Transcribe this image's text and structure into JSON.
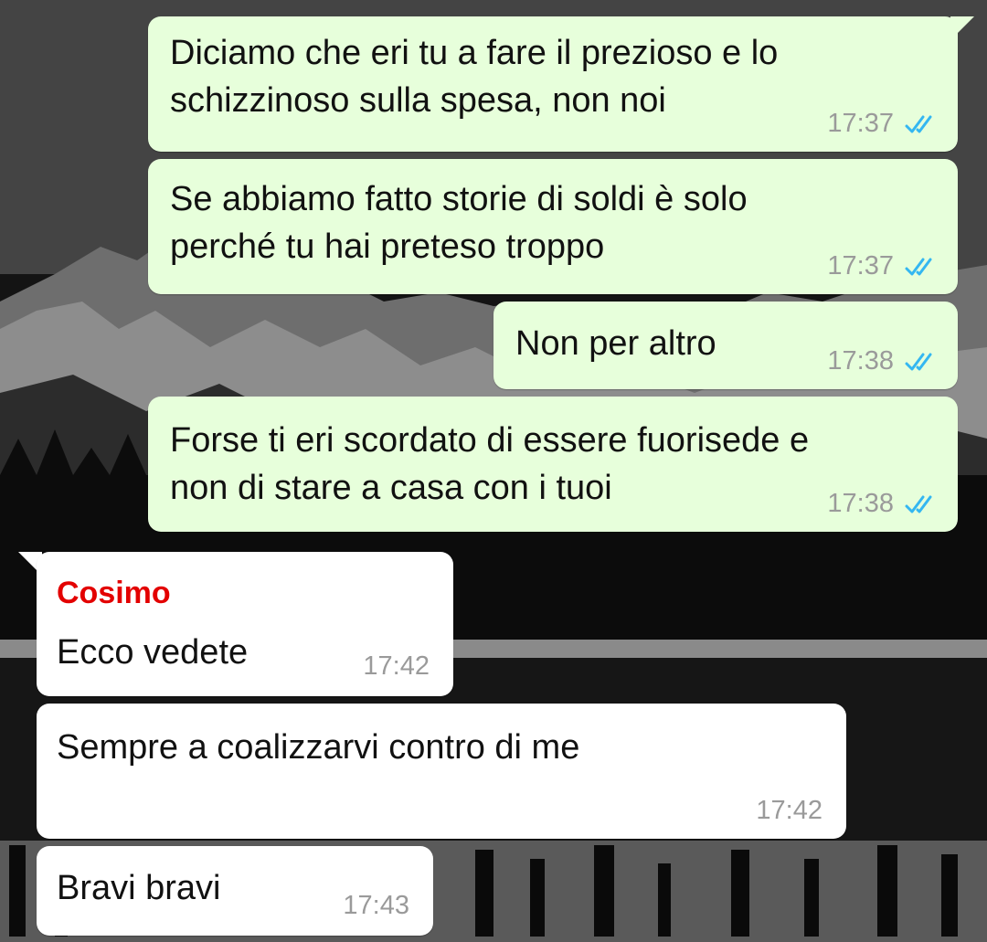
{
  "colors": {
    "outgoing_bubble": "#e7ffdb",
    "incoming_bubble": "#ffffff",
    "read_ticks": "#34b7f1",
    "sender_name": "#e30000",
    "timestamp": "#9a9a9a"
  },
  "messages": [
    {
      "direction": "outgoing",
      "lines": [
        "Diciamo che eri tu a fare il prezioso e lo",
        "schizzinoso sulla spesa, non noi"
      ],
      "time": "17:37",
      "status_icon": "double-check-read-icon"
    },
    {
      "direction": "outgoing",
      "lines": [
        "Se abbiamo fatto storie di soldi è solo",
        "perché tu hai preteso troppo"
      ],
      "time": "17:37",
      "status_icon": "double-check-read-icon"
    },
    {
      "direction": "outgoing",
      "lines": [
        "Non per altro"
      ],
      "time": "17:38",
      "status_icon": "double-check-read-icon"
    },
    {
      "direction": "outgoing",
      "lines": [
        "Forse ti eri scordato di essere fuorisede e",
        "non di stare a casa con i tuoi"
      ],
      "time": "17:38",
      "status_icon": "double-check-read-icon"
    },
    {
      "direction": "incoming",
      "sender": "Cosimo",
      "lines": [
        "Ecco vedete"
      ],
      "time": "17:42"
    },
    {
      "direction": "incoming",
      "lines": [
        "Sempre a coalizzarvi contro di me"
      ],
      "time": "17:42"
    },
    {
      "direction": "incoming",
      "lines": [
        "Bravi bravi"
      ],
      "time": "17:43"
    }
  ]
}
